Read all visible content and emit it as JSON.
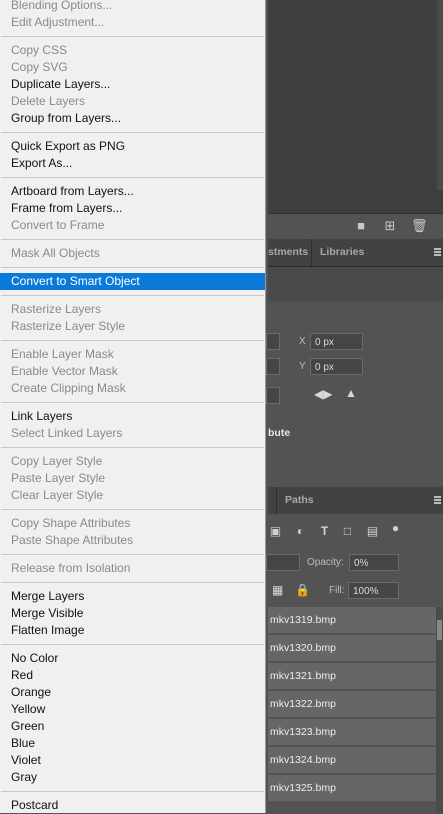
{
  "menu": {
    "items": [
      {
        "label": "Blending Options...",
        "disabled": true
      },
      {
        "label": "Edit Adjustment...",
        "disabled": true
      },
      {
        "label": "Copy CSS",
        "disabled": true
      },
      {
        "label": "Copy SVG",
        "disabled": true
      },
      {
        "label": "Duplicate Layers...",
        "disabled": false
      },
      {
        "label": "Delete Layers",
        "disabled": true
      },
      {
        "label": "Group from Layers...",
        "disabled": false
      },
      {
        "label": "Quick Export as PNG",
        "disabled": false
      },
      {
        "label": "Export As...",
        "disabled": false
      },
      {
        "label": "Artboard from Layers...",
        "disabled": false
      },
      {
        "label": "Frame from Layers...",
        "disabled": false
      },
      {
        "label": "Convert to Frame",
        "disabled": true
      },
      {
        "label": "Mask All Objects",
        "disabled": true
      },
      {
        "label": "Convert to Smart Object",
        "disabled": false,
        "highlighted": true
      },
      {
        "label": "Rasterize Layers",
        "disabled": true
      },
      {
        "label": "Rasterize Layer Style",
        "disabled": true
      },
      {
        "label": "Enable Layer Mask",
        "disabled": true
      },
      {
        "label": "Enable Vector Mask",
        "disabled": true
      },
      {
        "label": "Create Clipping Mask",
        "disabled": true
      },
      {
        "label": "Link Layers",
        "disabled": false
      },
      {
        "label": "Select Linked Layers",
        "disabled": true
      },
      {
        "label": "Copy Layer Style",
        "disabled": true
      },
      {
        "label": "Paste Layer Style",
        "disabled": true
      },
      {
        "label": "Clear Layer Style",
        "disabled": true
      },
      {
        "label": "Copy Shape Attributes",
        "disabled": true
      },
      {
        "label": "Paste Shape Attributes",
        "disabled": true
      },
      {
        "label": "Release from Isolation",
        "disabled": true
      },
      {
        "label": "Merge Layers",
        "disabled": false
      },
      {
        "label": "Merge Visible",
        "disabled": false
      },
      {
        "label": "Flatten Image",
        "disabled": false
      },
      {
        "label": "No Color",
        "disabled": false
      },
      {
        "label": "Red",
        "disabled": false
      },
      {
        "label": "Orange",
        "disabled": false
      },
      {
        "label": "Yellow",
        "disabled": false
      },
      {
        "label": "Green",
        "disabled": false
      },
      {
        "label": "Blue",
        "disabled": false
      },
      {
        "label": "Violet",
        "disabled": false
      },
      {
        "label": "Gray",
        "disabled": false
      },
      {
        "label": "Postcard",
        "disabled": false
      }
    ]
  },
  "tabs_top": {
    "adjustments": "stments",
    "libraries": "Libraries"
  },
  "properties": {
    "x_label": "X",
    "x_value": "0 px",
    "y_label": "Y",
    "y_value": "0 px",
    "attribute_heading": "bute"
  },
  "tabs_bottom": {
    "paths": "Paths"
  },
  "layers": {
    "opacity_label": "Opacity:",
    "opacity_value": "0%",
    "fill_label": "Fill:",
    "fill_value": "100%",
    "rows": [
      "mkv1319.bmp",
      "mkv1320.bmp",
      "mkv1321.bmp",
      "mkv1322.bmp",
      "mkv1323.bmp",
      "mkv1324.bmp",
      "mkv1325.bmp"
    ]
  },
  "colors": {
    "highlight": "#0b79d8",
    "menu_bg": "#f0f0f0",
    "panel_bg": "#535353"
  }
}
